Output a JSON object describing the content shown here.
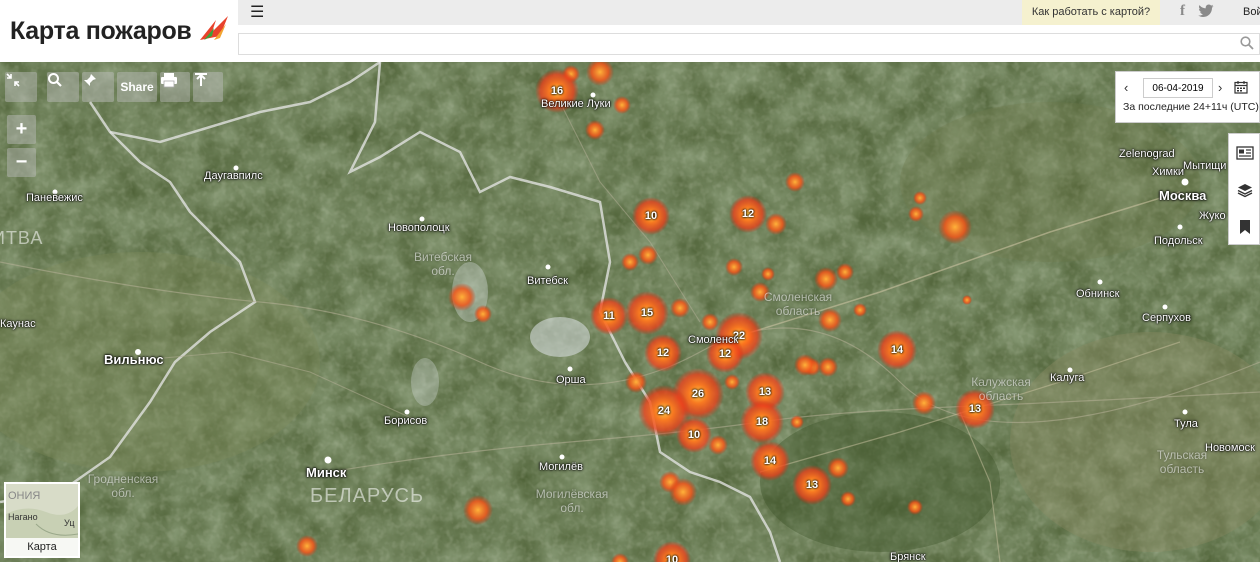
{
  "header": {
    "logo_text": "Карта пожаров",
    "help_link": "Как работать с картой?",
    "login": "Войти",
    "search_placeholder": ""
  },
  "toolbar": {
    "share_label": "Share",
    "zoom_in": "+",
    "zoom_out": "−"
  },
  "date_panel": {
    "date": "06-04-2019",
    "period": "За последние 24+11ч (UTC)"
  },
  "minimap": {
    "label": "Карта",
    "labels": [
      "ОНИЯ",
      "Нагано",
      "Уц"
    ]
  },
  "map_labels": {
    "cities": [
      {
        "name": "Великие Луки"
      },
      {
        "name": "Даугавпилс"
      },
      {
        "name": "Паневежис"
      },
      {
        "name": "Новополоцк"
      },
      {
        "name": "Витебск"
      },
      {
        "name": "Каунас"
      },
      {
        "name": "Вильнюс"
      },
      {
        "name": "Орша"
      },
      {
        "name": "Смоленск"
      },
      {
        "name": "Борисов"
      },
      {
        "name": "Минск"
      },
      {
        "name": "Могилёв"
      },
      {
        "name": "Zelenograd"
      },
      {
        "name": "Мытищи"
      },
      {
        "name": "Химки"
      },
      {
        "name": "Москва"
      },
      {
        "name": "Жуко"
      },
      {
        "name": "Подольск"
      },
      {
        "name": "Обнинск"
      },
      {
        "name": "Серпухов"
      },
      {
        "name": "Калуга"
      },
      {
        "name": "Тула"
      },
      {
        "name": "Новомоск"
      },
      {
        "name": "Брянск"
      }
    ],
    "regions": [
      {
        "name": "Витебская обл."
      },
      {
        "name": "Смоленская область"
      },
      {
        "name": "Калужская область"
      },
      {
        "name": "Тульская область"
      },
      {
        "name": "Гродненская обл."
      },
      {
        "name": "Могилёвская обл."
      }
    ],
    "countries": [
      {
        "name": "БЕЛАРУСЬ"
      },
      {
        "name": "ИТВА"
      }
    ]
  },
  "fire_clusters": [
    16,
    10,
    12,
    11,
    15,
    22,
    12,
    12,
    14,
    26,
    24,
    13,
    18,
    10,
    14,
    13,
    13,
    10
  ],
  "colors": {
    "fire": "#ff5a14",
    "fire_glow": "#ff9a3a",
    "header_bg": "#ececec",
    "help_bg": "#f5f1cf"
  }
}
